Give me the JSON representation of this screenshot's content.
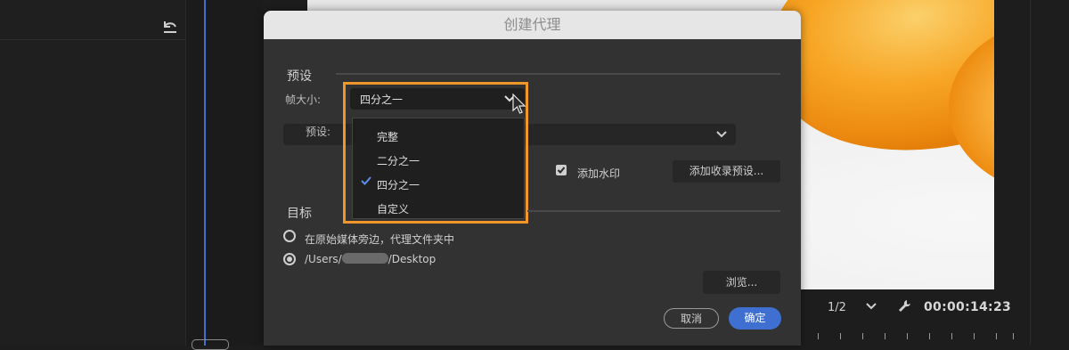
{
  "dialog": {
    "title": "创建代理",
    "preset_section": {
      "title": "预设",
      "frame_size_label": "帧大小:",
      "frame_size_value": "四分之一",
      "preset_label": "预设:",
      "watermark_label": "添加水印",
      "watermark_checked": true,
      "add_ingest_preset_button": "添加收录预设..."
    },
    "frame_size_dropdown": {
      "options": [
        "完整",
        "二分之一",
        "四分之一",
        "自定义"
      ],
      "selected": "四分之一"
    },
    "target_section": {
      "title": "目标",
      "option_beside_media": "在原始媒体旁边，代理文件夹中",
      "option_path_prefix": "/Users/",
      "option_path_suffix": "/Desktop",
      "selected_option": "path",
      "browse_button": "浏览..."
    },
    "cancel_button": "取消",
    "ok_button": "确定"
  },
  "monitor": {
    "resolution": "1/2",
    "timecode": "00:00:14:23"
  },
  "colors": {
    "accent_blue": "#3f6fd0",
    "highlight_orange": "#f0962a",
    "dialog_bg": "#323232",
    "titlebar_bg": "#e6e6e6"
  },
  "icons": [
    "undo-icon",
    "chevron-down-icon",
    "checkmark-icon",
    "wrench-icon",
    "mouse-cursor-icon"
  ]
}
